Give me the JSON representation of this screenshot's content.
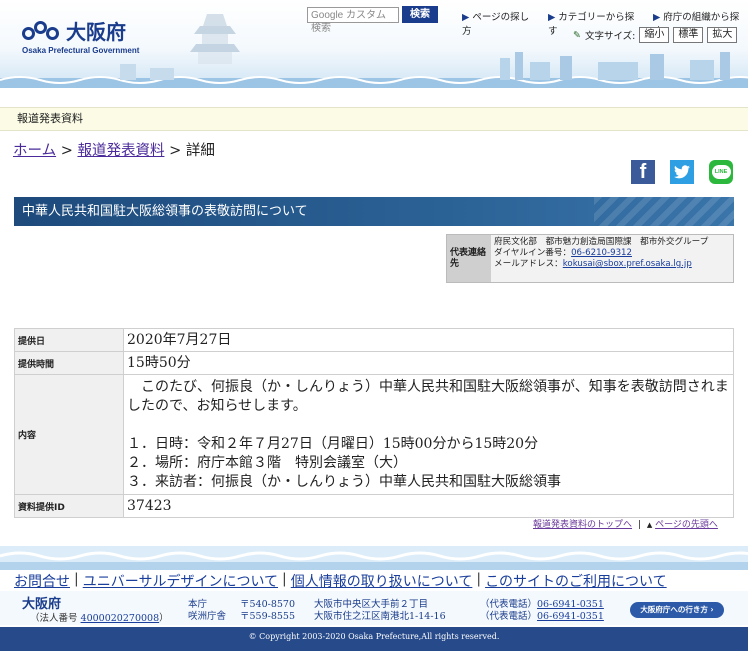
{
  "header": {
    "logo_text": "大阪府",
    "logo_subtext": "Osaka Prefectural Government",
    "search_placeholder": "Google カスタム検索",
    "search_button": "検索",
    "nav": [
      "ページの探し方",
      "カテゴリーから探す",
      "府庁の組織から探す"
    ],
    "font_size_label": "文字サイズ:",
    "font_size_options": [
      "縮小",
      "標準",
      "拡大"
    ]
  },
  "press_bar": {
    "label": "報道発表資料"
  },
  "breadcrumb": {
    "home": "ホーム",
    "sep1": ">",
    "press": "報道発表資料",
    "sep2": ">",
    "current": "詳細"
  },
  "social": {
    "facebook": "f",
    "line": "LINE"
  },
  "article": {
    "title": "中華人民共和国駐大阪総領事の表敬訪問について",
    "contact": {
      "label": "代表連絡先",
      "dept": "府民文化部　都市魅力創造局国際課　都市外交グループ",
      "dial_label": "ダイヤルイン番号：",
      "dial": "06-6210-9312",
      "mail_label": "メールアドレス：",
      "mail": "kokusai@sbox.pref.osaka.lg.jp"
    },
    "rows": {
      "date_label": "提供日",
      "date": "2020年7月27日",
      "time_label": "提供時間",
      "time": "15時50分",
      "content_label": "内容",
      "content_lines": [
        "　このたび、何振良（か・しんりょう）中華人民共和国駐大阪総領事が、知事を表敬訪問されましたので、お知らせします。",
        "",
        "１．日時：令和２年７月27日（月曜日）15時00分から15時20分",
        "２．場所：府庁本館３階　特別会議室（大）",
        "３．来訪者：何振良（か・しんりょう）中華人民共和国駐大阪総領事"
      ],
      "id_label": "資料提供ID",
      "id": "37423"
    }
  },
  "pagelinks": {
    "top": "報道発表資料のトップへ",
    "sep": "|",
    "arrow": "▲",
    "page_top": "ページの先頭へ"
  },
  "footer": {
    "links": [
      "お問合せ",
      "ユニバーサルデザインについて",
      "個人情報の取り扱いについて",
      "このサイトのご利用について"
    ],
    "sep": "|",
    "name": "大阪府",
    "corp_label": "（法人番号",
    "corp_no": "4000020270008",
    "corp_close": "）",
    "offices": [
      {
        "name": "本庁",
        "zip": "〒540-8570",
        "address": "大阪市中央区大手前２丁目",
        "tel_label": "（代表電話）",
        "tel": "06-6941-0351"
      },
      {
        "name": "咲洲庁舎",
        "zip": "〒559-8555",
        "address": "大阪市住之江区南港北1-14-16",
        "tel_label": "（代表電話）",
        "tel": "06-6941-0351"
      }
    ],
    "access_button": "大阪府庁への行き方 ›",
    "copyright": "© Copyright 2003-2020 Osaka Prefecture,All rights reserved."
  },
  "colors": {
    "brand": "#1a3c8c",
    "title_bar": "#2b6296",
    "footer": "#264a8a"
  }
}
